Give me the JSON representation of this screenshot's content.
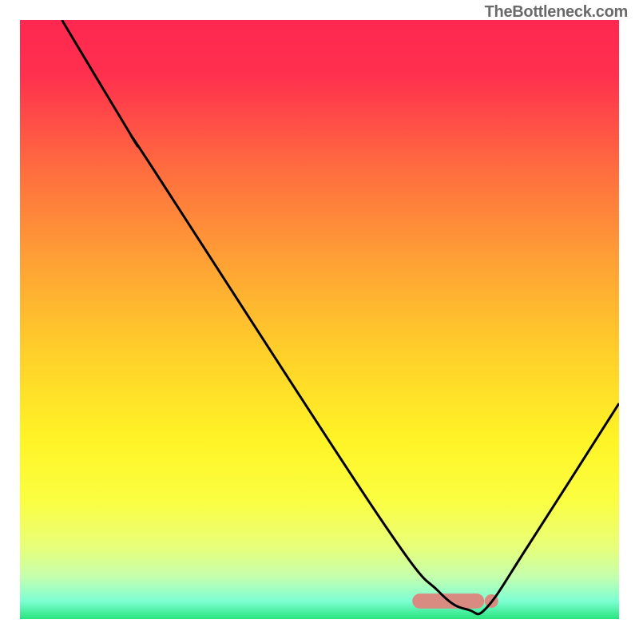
{
  "watermark": "TheBottleneck.com",
  "chart_data": {
    "type": "line",
    "title": "",
    "xlabel": "",
    "ylabel": "",
    "xlim": [
      0,
      100
    ],
    "ylim": [
      0,
      100
    ],
    "gradient_stops": [
      {
        "offset": 0.0,
        "color": "#ff2850"
      },
      {
        "offset": 0.09,
        "color": "#ff2f4e"
      },
      {
        "offset": 0.25,
        "color": "#ff6d3f"
      },
      {
        "offset": 0.4,
        "color": "#ffa035"
      },
      {
        "offset": 0.55,
        "color": "#ffce2a"
      },
      {
        "offset": 0.7,
        "color": "#fff426"
      },
      {
        "offset": 0.8,
        "color": "#fbfe40"
      },
      {
        "offset": 0.88,
        "color": "#e8ff7a"
      },
      {
        "offset": 0.93,
        "color": "#c4ffae"
      },
      {
        "offset": 0.97,
        "color": "#7dffd3"
      },
      {
        "offset": 1.0,
        "color": "#28e57e"
      }
    ],
    "series": [
      {
        "name": "bottleneck-curve",
        "color": "#000000",
        "points": [
          {
            "x": 7.0,
            "y": 100.0
          },
          {
            "x": 19.0,
            "y": 80.0
          },
          {
            "x": 22.0,
            "y": 75.5
          },
          {
            "x": 60.0,
            "y": 17.0
          },
          {
            "x": 70.0,
            "y": 4.5
          },
          {
            "x": 75.0,
            "y": 1.5
          },
          {
            "x": 78.0,
            "y": 2.0
          },
          {
            "x": 85.0,
            "y": 12.5
          },
          {
            "x": 100.0,
            "y": 36.0
          }
        ]
      }
    ],
    "markers": [
      {
        "name": "match-band",
        "x_start": 65.5,
        "x_end": 77.5,
        "y": 3.0,
        "color": "#d98b82",
        "height": 2.5
      }
    ]
  }
}
